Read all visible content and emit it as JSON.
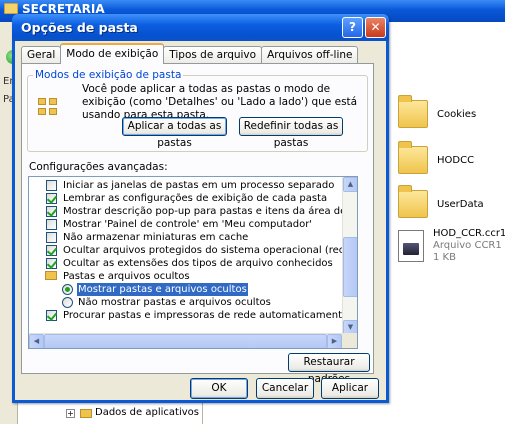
{
  "background_window": {
    "title": "SECRETARIA",
    "left_fragments": [
      "En",
      "Pas"
    ],
    "files": [
      {
        "name": "Cookies"
      },
      {
        "name": "HODCC"
      },
      {
        "name": "UserData"
      }
    ],
    "ccr_file": {
      "name": "HOD_CCR.ccr1",
      "type": "Arquivo CCR1",
      "size": "1 KB"
    },
    "tree_item": "Dados de aplicativos"
  },
  "dialog": {
    "title": "Opções de pasta",
    "help_symbol": "?",
    "close_symbol": "✕",
    "tabs": [
      {
        "label": "Geral",
        "active": false
      },
      {
        "label": "Modo de exibição",
        "active": true
      },
      {
        "label": "Tipos de arquivo",
        "active": false
      },
      {
        "label": "Arquivos off-line",
        "active": false
      }
    ],
    "view_group": {
      "legend": "Modos de exibição de pasta",
      "description": "Você pode aplicar a todas as pastas o modo de exibição (como 'Detalhes' ou 'Lado a lado') que está usando para esta pasta.",
      "apply_all_label": "Aplicar a todas as pastas",
      "reset_all_label": "Redefinir todas as pastas"
    },
    "advanced": {
      "label": "Configurações avançadas:",
      "items": [
        {
          "kind": "checkbox",
          "checked": false,
          "label": "Iniciar as janelas de pastas em um processo separado"
        },
        {
          "kind": "checkbox",
          "checked": true,
          "label": "Lembrar as configurações de exibição de cada pasta"
        },
        {
          "kind": "checkbox",
          "checked": true,
          "label": "Mostrar descrição pop-up para pastas e itens da área de trabalho"
        },
        {
          "kind": "checkbox",
          "checked": false,
          "label": "Mostrar 'Painel de controle' em 'Meu computador'"
        },
        {
          "kind": "checkbox",
          "checked": false,
          "label": "Não armazenar miniaturas em cache"
        },
        {
          "kind": "checkbox",
          "checked": true,
          "label": "Ocultar arquivos protegidos do sistema operacional (recomendado)"
        },
        {
          "kind": "checkbox",
          "checked": true,
          "label": "Ocultar as extensões dos tipos de arquivo conhecidos"
        },
        {
          "kind": "folder",
          "label": "Pastas e arquivos ocultos"
        },
        {
          "kind": "radio",
          "checked": true,
          "selected": true,
          "label": "Mostrar pastas e arquivos ocultos"
        },
        {
          "kind": "radio",
          "checked": false,
          "label": "Não mostrar pastas e arquivos ocultos"
        },
        {
          "kind": "checkbox",
          "checked": true,
          "label": "Procurar pastas e impressoras de rede automaticamente"
        }
      ]
    },
    "restore_label": "Restaurar padrões",
    "ok_label": "OK",
    "cancel_label": "Cancelar",
    "apply_label": "Aplicar"
  }
}
